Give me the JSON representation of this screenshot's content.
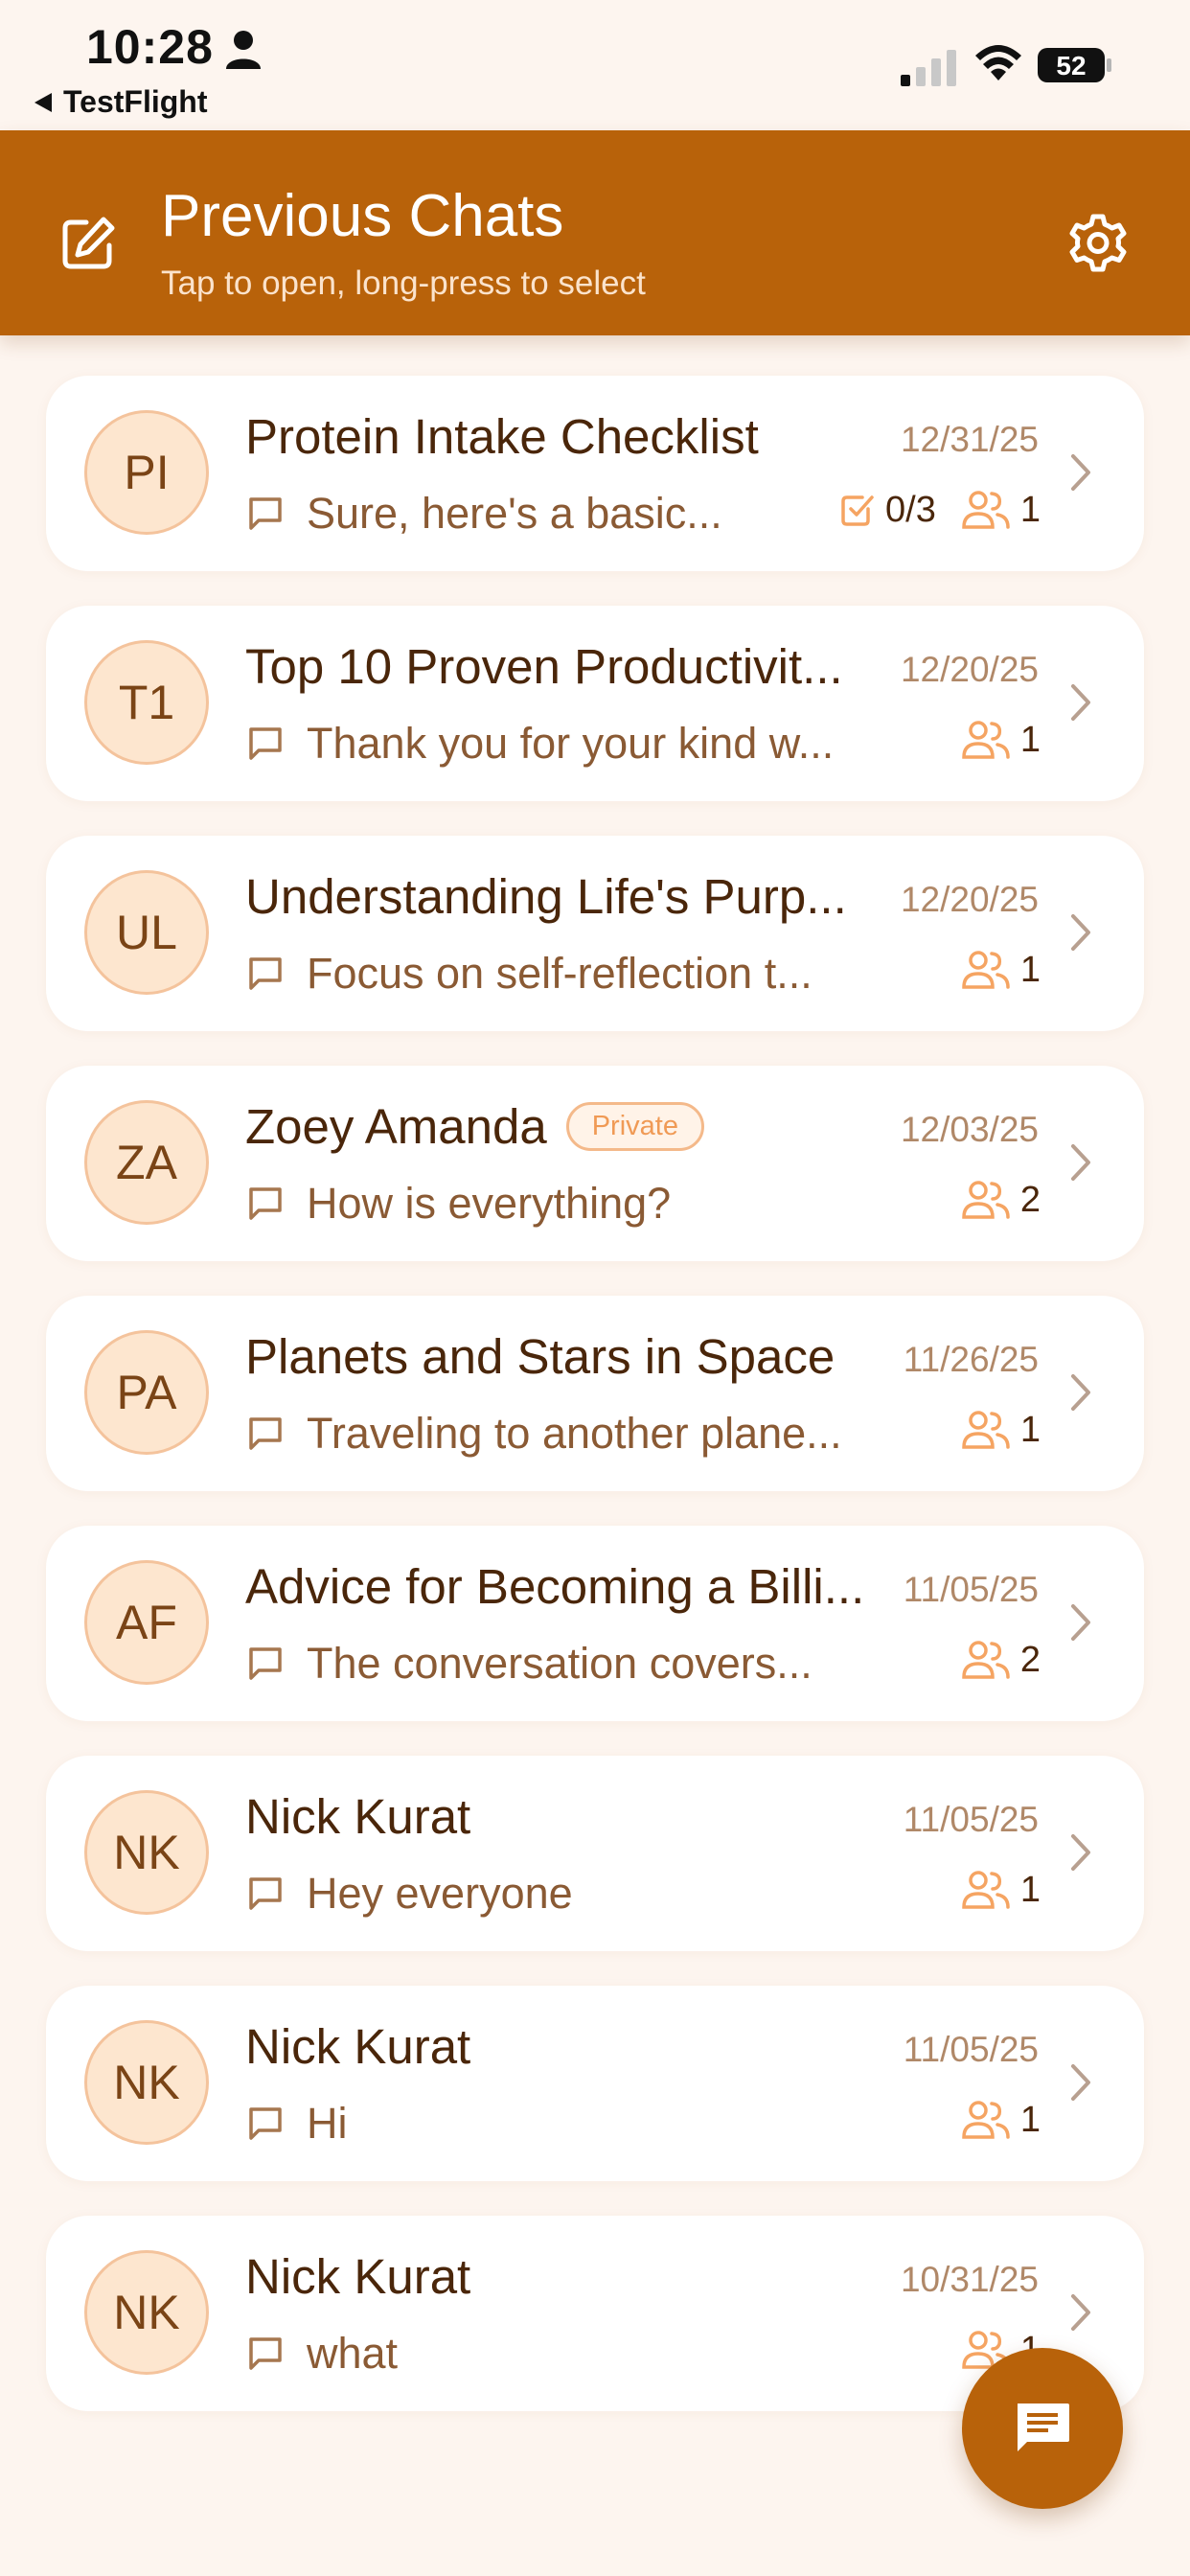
{
  "status_bar": {
    "time": "10:28",
    "back_label": "TestFlight",
    "battery": "52"
  },
  "header": {
    "title": "Previous Chats",
    "subtitle": "Tap to open, long-press to select",
    "background_color": "#b8620a"
  },
  "chats": [
    {
      "initials": "PI",
      "title": "Protein Intake Checklist",
      "private": "",
      "date": "12/31/25",
      "preview": "Sure, here's a basic...",
      "checklist": "0/3",
      "participants": "1"
    },
    {
      "initials": "T1",
      "title": "Top 10 Proven Productivit...",
      "private": "",
      "date": "12/20/25",
      "preview": "Thank you for your kind w...",
      "checklist": "",
      "participants": "1"
    },
    {
      "initials": "UL",
      "title": "Understanding Life's Purp...",
      "private": "",
      "date": "12/20/25",
      "preview": "Focus on self-reflection t...",
      "checklist": "",
      "participants": "1"
    },
    {
      "initials": "ZA",
      "title": "Zoey Amanda",
      "private": "Private",
      "date": "12/03/25",
      "preview": "How is everything?",
      "checklist": "",
      "participants": "2"
    },
    {
      "initials": "PA",
      "title": "Planets and Stars in Space",
      "private": "",
      "date": "11/26/25",
      "preview": "Traveling to another plane...",
      "checklist": "",
      "participants": "1"
    },
    {
      "initials": "AF",
      "title": "Advice for Becoming a Billi...",
      "private": "",
      "date": "11/05/25",
      "preview": "The conversation covers...",
      "checklist": "",
      "participants": "2"
    },
    {
      "initials": "NK",
      "title": "Nick Kurat",
      "private": "",
      "date": "11/05/25",
      "preview": "Hey everyone",
      "checklist": "",
      "participants": "1"
    },
    {
      "initials": "NK",
      "title": "Nick Kurat",
      "private": "",
      "date": "11/05/25",
      "preview": "Hi",
      "checklist": "",
      "participants": "1"
    },
    {
      "initials": "NK",
      "title": "Nick Kurat",
      "private": "",
      "date": "10/31/25",
      "preview": "what",
      "checklist": "",
      "participants": "1"
    }
  ]
}
